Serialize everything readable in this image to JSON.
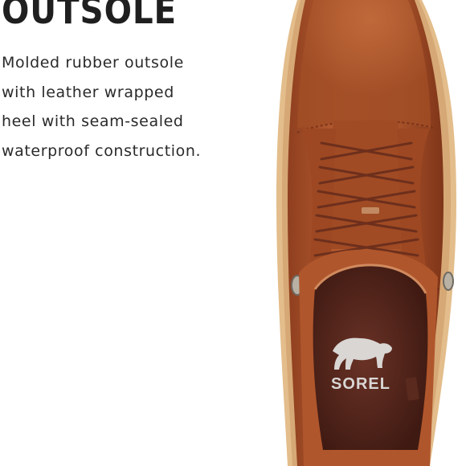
{
  "heading": "OUTSOLE",
  "description_lines": [
    "Molded rubber outsole",
    "with leather wrapped",
    "heel with seam-sealed",
    "waterproof construction."
  ],
  "product": {
    "brand_logo_text": "SOREL",
    "leather_color": "#b0562c",
    "outsole_color": "#e3bd8b",
    "lining_color": "#5a2a1e"
  }
}
